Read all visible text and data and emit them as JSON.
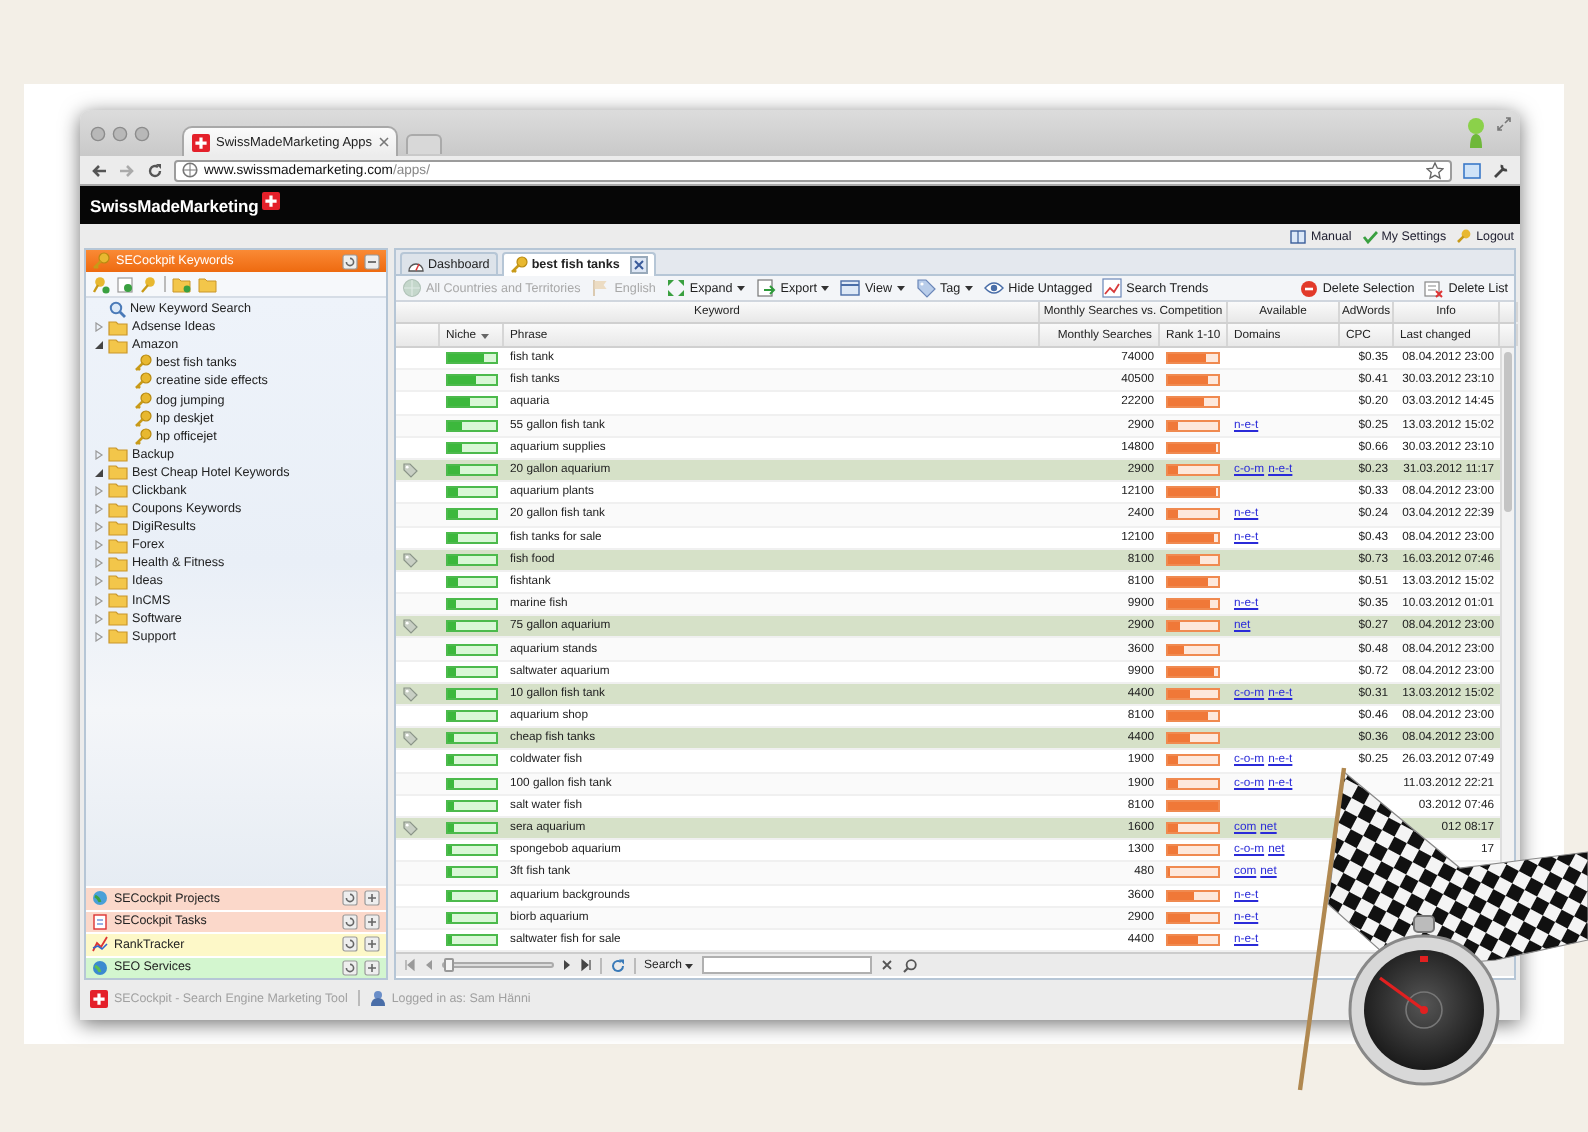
{
  "browser": {
    "tab_title": "SwissMadeMarketing Apps",
    "url_host": "www.swissmademarketing.com",
    "url_path": "/apps/"
  },
  "app": {
    "brand": "SwissMadeMarketing",
    "top_links": [
      "Manual",
      "My Settings",
      "Logout"
    ]
  },
  "sidebar": {
    "title": "SECockpit Keywords",
    "tree": [
      {
        "label": "New Keyword Search",
        "kind": "search"
      },
      {
        "label": "Adsense Ideas",
        "kind": "folder",
        "expanded": false
      },
      {
        "label": "Amazon",
        "kind": "folder",
        "expanded": true,
        "children": [
          {
            "label": "best fish tanks",
            "kind": "key"
          },
          {
            "label": "creatine side effects",
            "kind": "key"
          },
          {
            "label": "dog jumping",
            "kind": "key"
          },
          {
            "label": "hp deskjet",
            "kind": "key"
          },
          {
            "label": "hp officejet",
            "kind": "key"
          }
        ]
      },
      {
        "label": "Backup",
        "kind": "folder",
        "expanded": false
      },
      {
        "label": "Best Cheap Hotel Keywords",
        "kind": "folder",
        "expanded": true
      },
      {
        "label": "Clickbank",
        "kind": "folder",
        "expanded": false
      },
      {
        "label": "Coupons Keywords",
        "kind": "folder",
        "expanded": false
      },
      {
        "label": "DigiResults",
        "kind": "folder",
        "expanded": false
      },
      {
        "label": "Forex",
        "kind": "folder",
        "expanded": false
      },
      {
        "label": "Health & Fitness",
        "kind": "folder",
        "expanded": false
      },
      {
        "label": "Ideas",
        "kind": "folder",
        "expanded": false
      },
      {
        "label": "InCMS",
        "kind": "folder",
        "expanded": false
      },
      {
        "label": "Software",
        "kind": "folder",
        "expanded": false
      },
      {
        "label": "Support",
        "kind": "folder",
        "expanded": false
      }
    ],
    "panels": [
      {
        "label": "SECockpit Projects",
        "color": "#fbd8ca"
      },
      {
        "label": "SECockpit Tasks",
        "color": "#fbd8ca"
      },
      {
        "label": "RankTracker",
        "color": "#fdf8c8"
      },
      {
        "label": "SEO Services",
        "color": "#d3f6cf"
      }
    ]
  },
  "tabs": [
    {
      "label": "Dashboard",
      "selected": false,
      "closable": false
    },
    {
      "label": "best fish tanks",
      "selected": true,
      "closable": true
    }
  ],
  "toolbar": [
    {
      "label": "All Countries and Territories",
      "disabled": true,
      "menu": false
    },
    {
      "label": "English",
      "disabled": true,
      "menu": false
    },
    {
      "label": "Expand",
      "disabled": false,
      "menu": true
    },
    {
      "label": "Export",
      "disabled": false,
      "menu": true
    },
    {
      "label": "View",
      "disabled": false,
      "menu": true
    },
    {
      "label": "Tag",
      "disabled": false,
      "menu": true
    },
    {
      "label": "Hide Untagged",
      "disabled": false,
      "menu": false
    },
    {
      "label": "Search Trends",
      "disabled": false,
      "menu": false
    }
  ],
  "toolbar_right": [
    "Delete Selection",
    "Delete List"
  ],
  "table": {
    "groups": [
      {
        "label": "Keyword",
        "columns": [
          {
            "label": "Niche",
            "sorted": true
          },
          {
            "label": "Phrase",
            "sorted": false
          }
        ]
      },
      {
        "label": "Monthly Searches vs. Competition",
        "columns": [
          {
            "label": "Monthly Searches",
            "sorted": false
          },
          {
            "label": "Rank 1-10",
            "sorted": false
          }
        ]
      },
      {
        "label": "Available",
        "columns": [
          {
            "label": "Domains",
            "sorted": false
          }
        ]
      },
      {
        "label": "AdWords",
        "columns": [
          {
            "label": "CPC",
            "sorted": false
          }
        ]
      },
      {
        "label": "Info",
        "columns": [
          {
            "label": "Last changed",
            "sorted": false
          }
        ]
      }
    ],
    "rows": [
      {
        "tagged": false,
        "niche": {
          "level": 0.75
        },
        "phrase": "fish tank",
        "searches": "74000",
        "rank": {
          "level": 0.75
        },
        "cpc": "$0.35",
        "last_changed": "08.04.2012 23:00"
      },
      {
        "tagged": false,
        "niche": {
          "level": 0.6
        },
        "phrase": "fish tanks",
        "searches": "40500",
        "rank": {
          "level": 0.8
        },
        "cpc": "$0.41",
        "last_changed": "30.03.2012 23:10"
      },
      {
        "tagged": false,
        "niche": {
          "level": 0.45
        },
        "phrase": "aquaria",
        "searches": "22200",
        "rank": {
          "level": 0.7
        },
        "cpc": "$0.20",
        "last_changed": "03.03.2012 14:45"
      },
      {
        "tagged": false,
        "niche": {
          "level": 0.3
        },
        "phrase": "55 gallon fish tank",
        "searches": "2900",
        "rank": {
          "level": 0.2
        },
        "domains": [
          "n-e-t"
        ],
        "cpc": "$0.25",
        "last_changed": "13.03.2012 15:02"
      },
      {
        "tagged": false,
        "niche": {
          "level": 0.28
        },
        "phrase": "aquarium supplies",
        "searches": "14800",
        "rank": {
          "level": 0.95
        },
        "cpc": "$0.66",
        "last_changed": "30.03.2012 23:10"
      },
      {
        "tagged": true,
        "niche": {
          "level": 0.25
        },
        "phrase": "20 gallon aquarium",
        "searches": "2900",
        "rank": {
          "level": 0.2
        },
        "domains": [
          "c-o-m",
          "n-e-t"
        ],
        "cpc": "$0.23",
        "last_changed": "31.03.2012 11:17"
      },
      {
        "tagged": false,
        "niche": {
          "level": 0.22
        },
        "phrase": "aquarium plants",
        "searches": "12100",
        "rank": {
          "level": 0.95
        },
        "cpc": "$0.33",
        "last_changed": "08.04.2012 23:00"
      },
      {
        "tagged": false,
        "niche": {
          "level": 0.2
        },
        "phrase": "20 gallon fish tank",
        "searches": "2400",
        "rank": {
          "level": 0.2
        },
        "domains": [
          "n-e-t"
        ],
        "cpc": "$0.24",
        "last_changed": "03.04.2012 22:39"
      },
      {
        "tagged": false,
        "niche": {
          "level": 0.2
        },
        "phrase": "fish tanks for sale",
        "searches": "12100",
        "rank": {
          "level": 0.9
        },
        "domains": [
          "n-e-t"
        ],
        "cpc": "$0.43",
        "last_changed": "08.04.2012 23:00"
      },
      {
        "tagged": true,
        "niche": {
          "level": 0.2
        },
        "phrase": "fish food",
        "searches": "8100",
        "rank": {
          "level": 0.65
        },
        "cpc": "$0.73",
        "last_changed": "16.03.2012 07:46"
      },
      {
        "tagged": false,
        "niche": {
          "level": 0.2
        },
        "phrase": "fishtank",
        "searches": "8100",
        "rank": {
          "level": 0.8
        },
        "cpc": "$0.51",
        "last_changed": "13.03.2012 15:02"
      },
      {
        "tagged": false,
        "niche": {
          "level": 0.18
        },
        "phrase": "marine fish",
        "searches": "9900",
        "rank": {
          "level": 0.85
        },
        "domains": [
          "n-e-t"
        ],
        "cpc": "$0.35",
        "last_changed": "10.03.2012 01:01"
      },
      {
        "tagged": true,
        "niche": {
          "level": 0.18
        },
        "phrase": "75 gallon aquarium",
        "searches": "2900",
        "rank": {
          "level": 0.25
        },
        "domains": [
          "net"
        ],
        "cpc": "$0.27",
        "last_changed": "08.04.2012 23:00"
      },
      {
        "tagged": false,
        "niche": {
          "level": 0.16
        },
        "phrase": "aquarium stands",
        "searches": "3600",
        "rank": {
          "level": 0.3
        },
        "cpc": "$0.48",
        "last_changed": "08.04.2012 23:00"
      },
      {
        "tagged": false,
        "niche": {
          "level": 0.16
        },
        "phrase": "saltwater aquarium",
        "searches": "9900",
        "rank": {
          "level": 0.9
        },
        "cpc": "$0.72",
        "last_changed": "08.04.2012 23:00"
      },
      {
        "tagged": true,
        "niche": {
          "level": 0.16
        },
        "phrase": "10 gallon fish tank",
        "searches": "4400",
        "rank": {
          "level": 0.45
        },
        "domains": [
          "c-o-m",
          "n-e-t"
        ],
        "cpc": "$0.31",
        "last_changed": "13.03.2012 15:02"
      },
      {
        "tagged": false,
        "niche": {
          "level": 0.15
        },
        "phrase": "aquarium shop",
        "searches": "8100",
        "rank": {
          "level": 0.8
        },
        "cpc": "$0.46",
        "last_changed": "08.04.2012 23:00"
      },
      {
        "tagged": true,
        "niche": {
          "level": 0.14
        },
        "phrase": "cheap fish tanks",
        "searches": "4400",
        "rank": {
          "level": 0.45
        },
        "cpc": "$0.36",
        "last_changed": "08.04.2012 23:00"
      },
      {
        "tagged": false,
        "niche": {
          "level": 0.13
        },
        "phrase": "coldwater fish",
        "searches": "1900",
        "rank": {
          "level": 0.2
        },
        "domains": [
          "c-o-m",
          "n-e-t"
        ],
        "cpc": "$0.25",
        "last_changed": "26.03.2012 07:49"
      },
      {
        "tagged": false,
        "niche": {
          "level": 0.13
        },
        "phrase": "100 gallon fish tank",
        "searches": "1900",
        "rank": {
          "level": 0.2
        },
        "domains": [
          "c-o-m",
          "n-e-t"
        ],
        "last_changed": "11.03.2012 22:21"
      },
      {
        "tagged": false,
        "niche": {
          "level": 0.12
        },
        "phrase": "salt water fish",
        "searches": "8100",
        "rank": {
          "level": 0.98
        },
        "last_changed": "03.2012 07:46"
      },
      {
        "tagged": true,
        "niche": {
          "level": 0.12
        },
        "phrase": "sera aquarium",
        "searches": "1600",
        "rank": {
          "level": 0.2
        },
        "domains": [
          "com",
          "net"
        ],
        "last_changed": "012 08:17"
      },
      {
        "tagged": false,
        "niche": {
          "level": 0.1
        },
        "phrase": "spongebob aquarium",
        "searches": "1300",
        "rank": {
          "level": 0.2
        },
        "domains": [
          "c-o-m",
          "net"
        ],
        "last_changed": "17"
      },
      {
        "tagged": false,
        "niche": {
          "level": 0.1
        },
        "phrase": "3ft fish tank",
        "searches": "480",
        "rank": {
          "level": 0.05
        },
        "domains": [
          "com",
          "net"
        ]
      },
      {
        "tagged": false,
        "niche": {
          "level": 0.08
        },
        "phrase": "aquarium backgrounds",
        "searches": "3600",
        "rank": {
          "level": 0.5
        },
        "domains": [
          "n-e-t"
        ]
      },
      {
        "tagged": false,
        "niche": {
          "level": 0.08
        },
        "phrase": "biorb aquarium",
        "searches": "2900",
        "rank": {
          "level": 0.45
        },
        "domains": [
          "n-e-t"
        ]
      },
      {
        "tagged": false,
        "niche": {
          "level": 0.08
        },
        "phrase": "saltwater fish for sale",
        "searches": "4400",
        "rank": {
          "level": 0.6
        },
        "domains": [
          "n-e-t"
        ]
      }
    ]
  },
  "pager": {
    "slider": {
      "level": 0
    },
    "search_label": "Search"
  },
  "status_bar": {
    "app_name": "SECockpit - Search Engine Marketing Tool",
    "login": "Logged in as: Sam Hänni"
  }
}
